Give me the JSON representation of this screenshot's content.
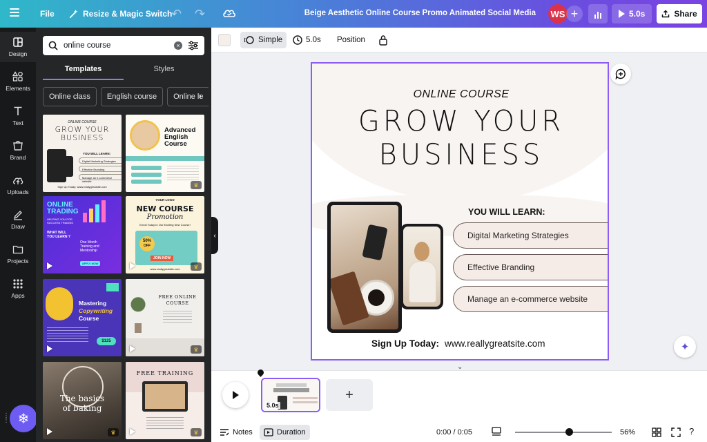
{
  "topbar": {
    "file": "File",
    "resize": "Resize & Magic Switch",
    "title": "Beige Aesthetic Online Course Promo Animated Social Media",
    "avatar_initials": "WS",
    "add": "+",
    "play_duration": "5.0s",
    "share": "Share"
  },
  "rail": {
    "items": [
      "Design",
      "Elements",
      "Text",
      "Brand",
      "Uploads",
      "Draw",
      "Projects",
      "Apps"
    ]
  },
  "panel": {
    "search_value": "online course",
    "tabs": [
      "Templates",
      "Styles"
    ],
    "chips": [
      "Online class",
      "English course",
      "Online le"
    ],
    "thumbs": {
      "t1": {
        "a": "ONLINE COURSE",
        "b": "GROW YOUR",
        "c": "BUSINESS",
        "d": "YOU WILL LEARN:",
        "e": "Digital Marketing Strategies",
        "f": "Effective Branding",
        "g": "Manage an e-commerce website",
        "h": "Sign Up Today:  www.reallygreatsite.com"
      },
      "t2": {
        "a": "Advanced",
        "b": "English",
        "c": "Course"
      },
      "t3": {
        "a": "ONLINE",
        "b": "TRADING",
        "c": "HELPING YOU FOR",
        "d": "SUCCESS TRADING",
        "e": "WHAT WILL",
        "f": "YOU LEARN ?",
        "g": "One Month",
        "h": "Training and",
        "i": "Mentorship",
        "j": "APPLY NOW"
      },
      "t4": {
        "a": "YOUR LOGO",
        "b": "NEW COURSE",
        "c": "Promotion",
        "d": "Enroll Today In Our Exciting New Course!",
        "e": "50%",
        "f": "OFF",
        "g": "JOIN NOW",
        "h": "www.reallygreatsite.com"
      },
      "t5": {
        "a": "Mastering",
        "b": "Copywriting",
        "c": "Course",
        "d": "$125"
      },
      "t6": {
        "a": "FREE ONLINE",
        "b": "COURSE"
      },
      "t7": {
        "a": "The basics",
        "b": "of baking"
      },
      "t8": {
        "a": "FREE TRAINING"
      }
    }
  },
  "toolbar": {
    "simple": "Simple",
    "duration": "5.0s",
    "position": "Position"
  },
  "design": {
    "kicker": "ONLINE COURSE",
    "headline_1": "GROW YOUR",
    "headline_2": "BUSINESS",
    "learn_heading": "YOU WILL LEARN:",
    "items": [
      "Digital Marketing Strategies",
      "Effective Branding",
      "Manage an e-commerce website"
    ],
    "signup_label": "Sign  Up Today:",
    "signup_url": "www.reallygreatsite.com"
  },
  "timeline": {
    "clip_duration": "5.0s",
    "add": "+"
  },
  "bottombar": {
    "notes": "Notes",
    "duration": "Duration",
    "time": "0:00 / 0:05",
    "zoom": "56%",
    "zoom_fraction": 0.56
  }
}
